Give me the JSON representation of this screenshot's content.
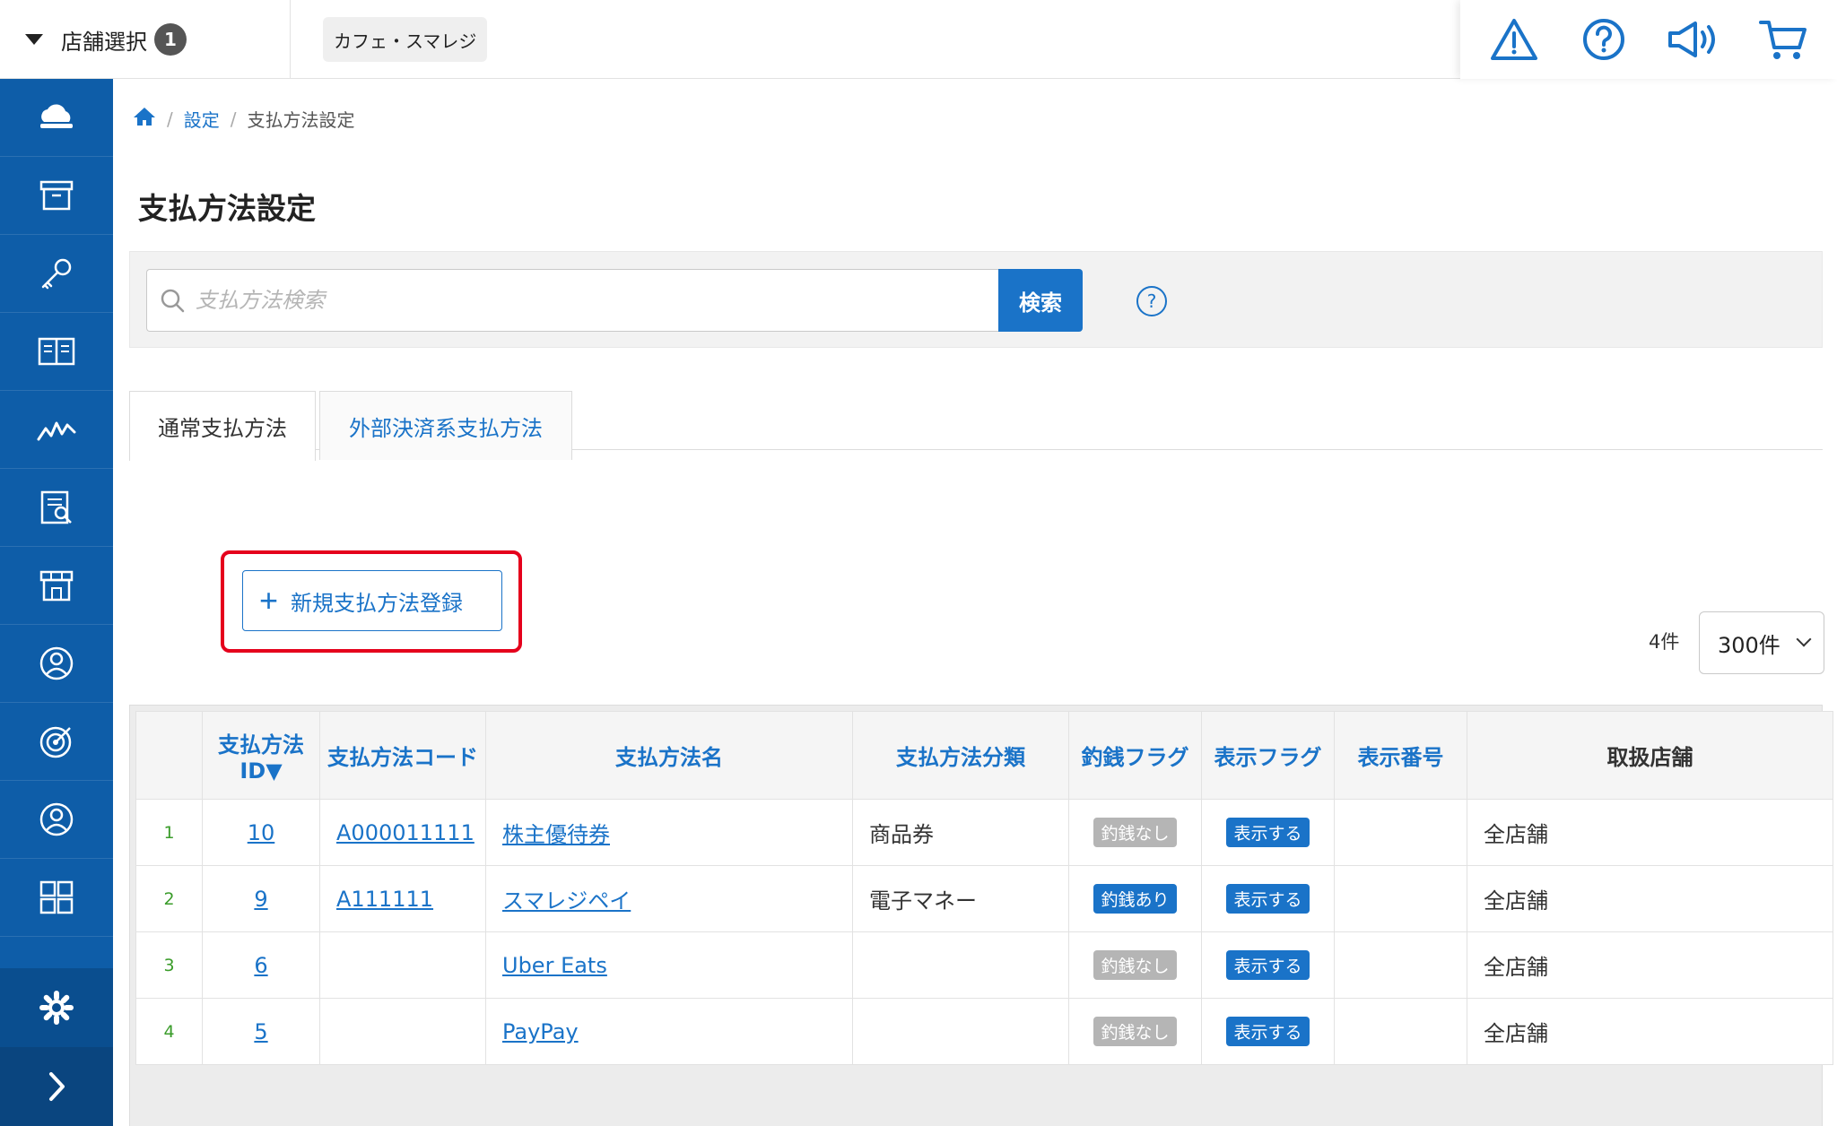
{
  "topbar": {
    "store_select_label": "店舗選択",
    "store_count": "1",
    "shop_name": "カフェ・スマレジ",
    "icons": [
      "warning-icon",
      "help-icon",
      "announcement-icon",
      "cart-icon"
    ]
  },
  "sidebar": {
    "items": [
      "cloud-icon",
      "archive-icon",
      "key-icon",
      "book-icon",
      "chart-icon",
      "report-icon",
      "store-icon",
      "customer-icon",
      "target-icon",
      "user-icon",
      "apps-icon"
    ],
    "bottom": [
      "gear-icon",
      "chevron-right-icon"
    ]
  },
  "breadcrumb": {
    "settings": "設定",
    "current": "支払方法設定"
  },
  "page": {
    "title": "支払方法設定"
  },
  "search": {
    "placeholder": "支払方法検索",
    "button_label": "検索",
    "help_label": "?"
  },
  "tabs": {
    "normal": "通常支払方法",
    "external": "外部決済系支払方法"
  },
  "actions": {
    "add_label": "新規支払方法登録"
  },
  "pagination": {
    "count": "4件",
    "per_page": "300件"
  },
  "table": {
    "headers": {
      "id_line1": "支払方法",
      "id_line2": "ID▼",
      "code": "支払方法コード",
      "name": "支払方法名",
      "category": "支払方法分類",
      "change_flag": "釣銭フラグ",
      "display_flag": "表示フラグ",
      "display_order": "表示番号",
      "stores": "取扱店舗"
    },
    "rows": [
      {
        "no": "1",
        "id": "10",
        "code": "A000011111",
        "name": "株主優待券",
        "category": "商品券",
        "change_flag": "釣銭なし",
        "display_flag": "表示する",
        "display_order": "",
        "stores": "全店舗"
      },
      {
        "no": "2",
        "id": "9",
        "code": "A111111",
        "name": "スマレジペイ",
        "category": "電子マネー",
        "change_flag": "釣銭あり",
        "display_flag": "表示する",
        "display_order": "",
        "stores": "全店舗"
      },
      {
        "no": "3",
        "id": "6",
        "code": "",
        "name": "Uber Eats",
        "category": "",
        "change_flag": "釣銭なし",
        "display_flag": "表示する",
        "display_order": "",
        "stores": "全店舗"
      },
      {
        "no": "4",
        "id": "5",
        "code": "",
        "name": "PayPay",
        "category": "",
        "change_flag": "釣銭なし",
        "display_flag": "表示する",
        "display_order": "",
        "stores": "全店舗"
      }
    ]
  }
}
